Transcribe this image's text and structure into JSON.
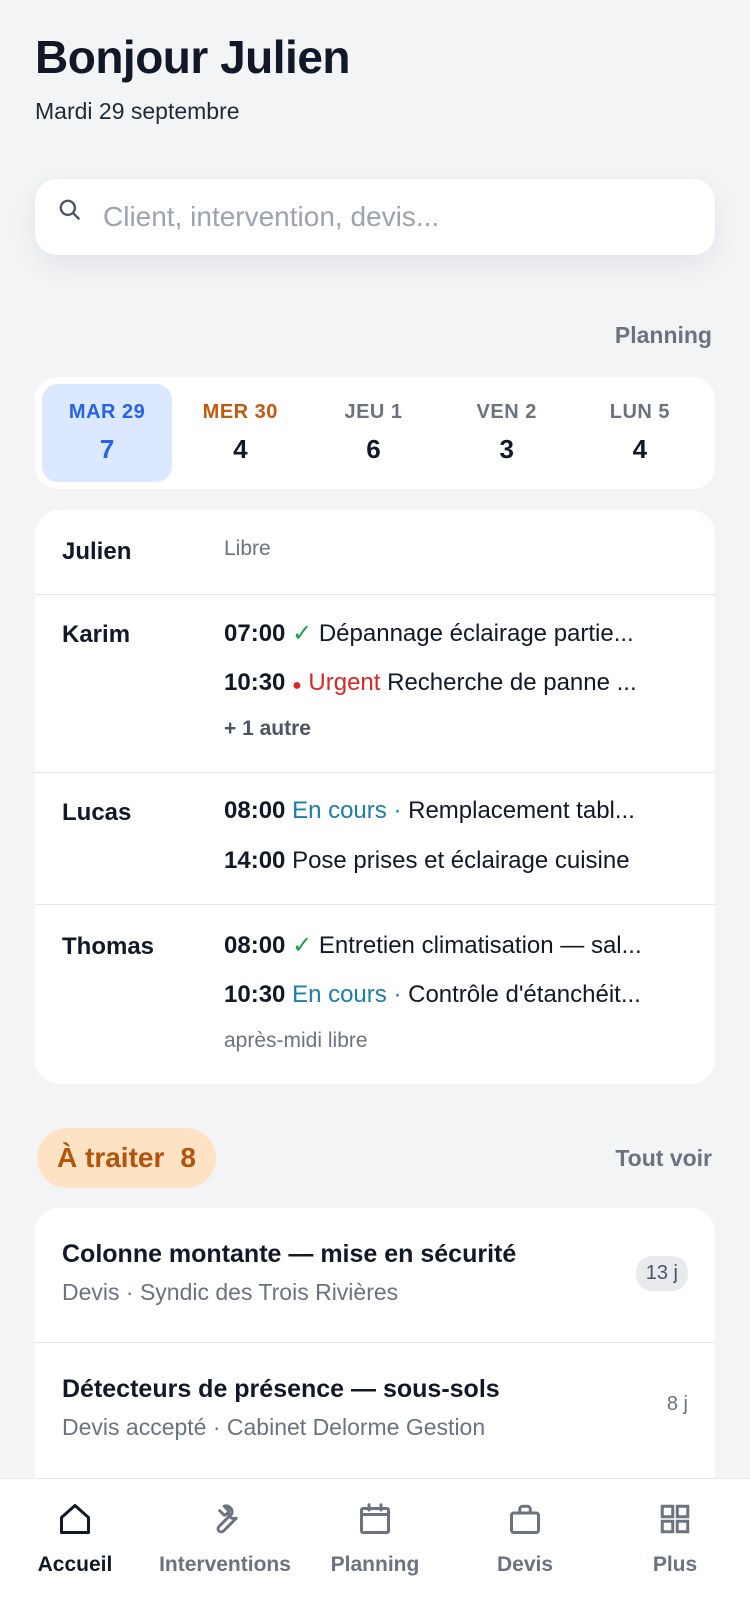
{
  "header": {
    "greeting": "Bonjour Julien",
    "date": "Mardi 29 septembre"
  },
  "search": {
    "placeholder": "Client, intervention, devis..."
  },
  "planning_link": "Planning",
  "days": [
    {
      "label": "MAR 29",
      "count": "7"
    },
    {
      "label": "MER 30",
      "count": "4"
    },
    {
      "label": "JEU 1",
      "count": "6"
    },
    {
      "label": "VEN 2",
      "count": "3"
    },
    {
      "label": "LUN 5",
      "count": "4"
    }
  ],
  "team": {
    "julien": {
      "name": "Julien",
      "status": "Libre"
    },
    "karim": {
      "name": "Karim",
      "lines": [
        {
          "time": "07:00",
          "mark": "✓",
          "text": "Dépannage éclairage partie..."
        },
        {
          "time": "10:30",
          "mark": "●",
          "tag": "Urgent",
          "text": "Recherche de panne ..."
        }
      ],
      "more": "+ 1 autre"
    },
    "lucas": {
      "name": "Lucas",
      "lines": [
        {
          "time": "08:00",
          "tag": "En cours ·",
          "text": "Remplacement tabl..."
        },
        {
          "time": "14:00",
          "text": "Pose prises et éclairage cuisine"
        }
      ]
    },
    "thomas": {
      "name": "Thomas",
      "lines": [
        {
          "time": "08:00",
          "mark": "✓",
          "text": "Entretien climatisation — sal..."
        },
        {
          "time": "10:30",
          "tag": "En cours ·",
          "text": "Contrôle d'étanchéit..."
        }
      ],
      "note": "après-midi libre"
    }
  },
  "todo": {
    "label": "À traiter",
    "count": "8",
    "see_all": "Tout voir"
  },
  "tasks": [
    {
      "title": "Colonne montante — mise en sécurité",
      "subtitle": "Devis · Syndic des Trois Rivières",
      "age": "13 j"
    },
    {
      "title": "Détecteurs de présence — sous-sols",
      "subtitle": "Devis accepté · Cabinet Delorme Gestion",
      "age": "8 j"
    }
  ],
  "tabs": [
    {
      "label": "Accueil",
      "icon": "home-icon"
    },
    {
      "label": "Interventions",
      "icon": "wrench-icon"
    },
    {
      "label": "Planning",
      "icon": "calendar-icon"
    },
    {
      "label": "Devis",
      "icon": "briefcase-icon"
    },
    {
      "label": "Plus",
      "icon": "grid-icon"
    }
  ],
  "colors": {
    "accent": "#2563eb",
    "warning": "#b45309",
    "urgent": "#dc2626",
    "in_progress": "#1a7fa6",
    "done": "#16a34a"
  }
}
